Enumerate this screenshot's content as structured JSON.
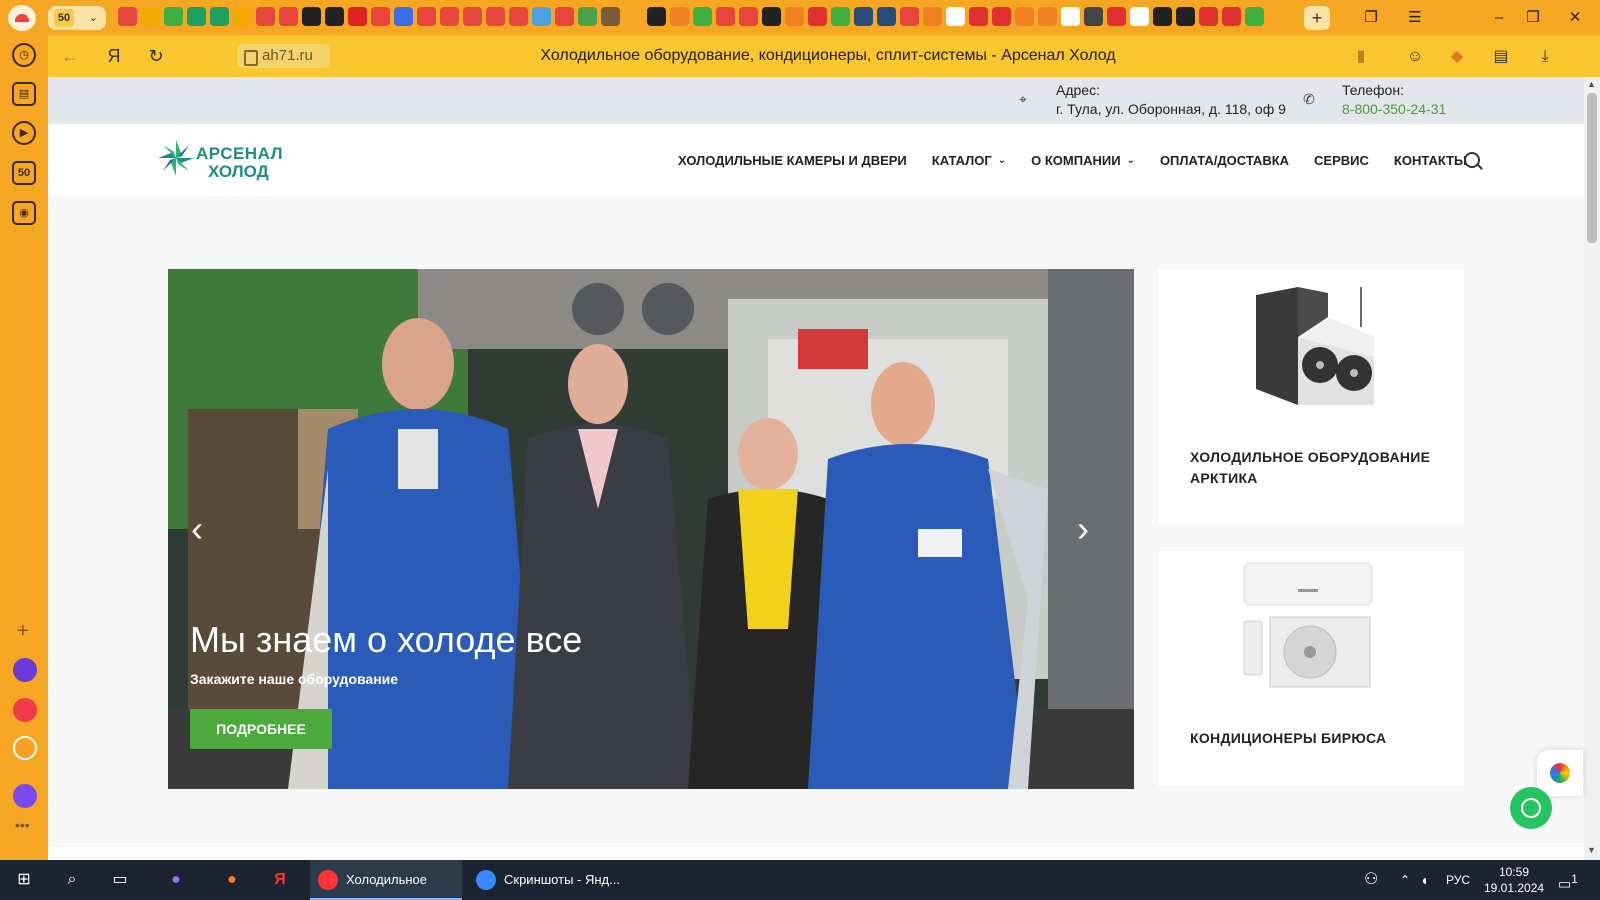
{
  "browser": {
    "tab_badge": "50",
    "page_title": "Холодильное оборудование, кондиционеры, сплит-системы - Арсенал Холод",
    "url": "ah71.ru",
    "tab_icon_colors": [
      "#e8453c",
      "#f2a900",
      "#3db03d",
      "#20a060",
      "#20a060",
      "#f2a900",
      "#e8453c",
      "#e8453c",
      "#222222",
      "#222222",
      "#d22",
      "#e8453c",
      "#3a6ee8",
      "#e8453c",
      "#e8453c",
      "#e8453c",
      "#e8453c",
      "#e8453c",
      "#4aa3df",
      "#e8453c",
      "#4aa34a",
      "#7a5a3a",
      "#f5a623",
      "#222222",
      "#f08020",
      "#3db03d",
      "#e8453c",
      "#e8453c",
      "#222222",
      "#f08020",
      "#e03030",
      "#3db03d",
      "#2a4a7a",
      "#2a4a7a",
      "#e8453c",
      "#f08020",
      "#ffffff",
      "#e03030",
      "#e03030",
      "#f08020",
      "#f08020",
      "#ffffff",
      "#444444",
      "#e03030",
      "#ffffff",
      "#222222",
      "#222222",
      "#e03030",
      "#e03030",
      "#3db03d"
    ]
  },
  "sidebar": {
    "badge": "50"
  },
  "site": {
    "address_label": "Адрес:",
    "address_value": "г. Тула, ул. Оборонная, д. 118, оф 9",
    "phone_label": "Телефон:",
    "phone_value": "8-800-350-24-31",
    "logo_line1": "АРСЕНАЛ",
    "logo_line2": "ХОЛОД",
    "menu": [
      {
        "label": "ХОЛОДИЛЬНЫЕ КАМЕРЫ И ДВЕРИ",
        "dropdown": false
      },
      {
        "label": "КАТАЛОГ",
        "dropdown": true
      },
      {
        "label": "О КОМПАНИИ",
        "dropdown": true
      },
      {
        "label": "ОПЛАТА/ДОСТАВКА",
        "dropdown": false
      },
      {
        "label": "СЕРВИС",
        "dropdown": false
      },
      {
        "label": "КОНТАКТЫ",
        "dropdown": false
      }
    ],
    "slider": {
      "headline": "Мы знаем о холоде все",
      "subline": "Закажите наше оборудование",
      "button": "ПОДРОБНЕЕ"
    },
    "cards": [
      {
        "title": "ХОЛОДИЛЬНОЕ ОБОРУДОВАНИЕ АРКТИКА"
      },
      {
        "title": "КОНДИЦИОНЕРЫ БИРЮСА"
      }
    ]
  },
  "taskbar": {
    "apps": [
      {
        "label": "Холодильное обо...",
        "active": true
      },
      {
        "label": "Скриншоты - Янд...",
        "active": false
      }
    ],
    "lang": "РУС",
    "time": "10:59",
    "date": "19.01.2024",
    "notif_count": "1"
  }
}
